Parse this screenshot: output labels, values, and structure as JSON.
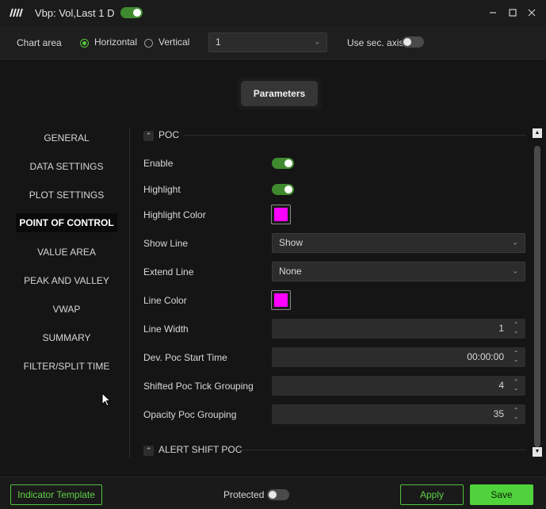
{
  "window": {
    "title": "Vbp: Vol,Last 1 D",
    "enabled": true,
    "controls": [
      "minimize-icon",
      "maximize-icon",
      "close-icon"
    ]
  },
  "toolbar": {
    "chart_area_label": "Chart area",
    "orientation_options": [
      "Horizontal",
      "Vertical"
    ],
    "orientation_selected": "Horizontal",
    "pane_value": "1",
    "sec_axis_label": "Use sec. axis",
    "sec_axis_enabled": false
  },
  "tabs": {
    "parameters_label": "Parameters"
  },
  "nav": {
    "items": [
      "GENERAL",
      "DATA SETTINGS",
      "PLOT SETTINGS",
      "POINT OF CONTROL",
      "VALUE AREA",
      "PEAK AND VALLEY",
      "VWAP",
      "SUMMARY",
      "FILTER/SPLIT TIME"
    ],
    "active": "POINT OF CONTROL"
  },
  "section_poc": {
    "title": "POC",
    "enable_label": "Enable",
    "enable_value": true,
    "highlight_label": "Highlight",
    "highlight_value": true,
    "highlight_color_label": "Highlight Color",
    "highlight_color": "#ff00ff",
    "show_line_label": "Show Line",
    "show_line_value": "Show",
    "extend_line_label": "Extend Line",
    "extend_line_value": "None",
    "line_color_label": "Line Color",
    "line_color": "#ff00ff",
    "line_width_label": "Line Width",
    "line_width_value": "1",
    "dev_poc_start_label": "Dev. Poc Start Time",
    "dev_poc_start_value": "00:00:00",
    "shifted_poc_label": "Shifted Poc Tick Grouping",
    "shifted_poc_value": "4",
    "opacity_poc_label": "Opacity Poc Grouping",
    "opacity_poc_value": "35"
  },
  "section_alert": {
    "title": "ALERT SHIFT POC"
  },
  "footer": {
    "template_label": "Indicator Template",
    "protected_label": "Protected",
    "protected_value": false,
    "apply_label": "Apply",
    "save_label": "Save"
  },
  "colors": {
    "accent": "#4fd23b",
    "toggle_on": "#3f8a2f",
    "swatch": "#ff00ff"
  }
}
